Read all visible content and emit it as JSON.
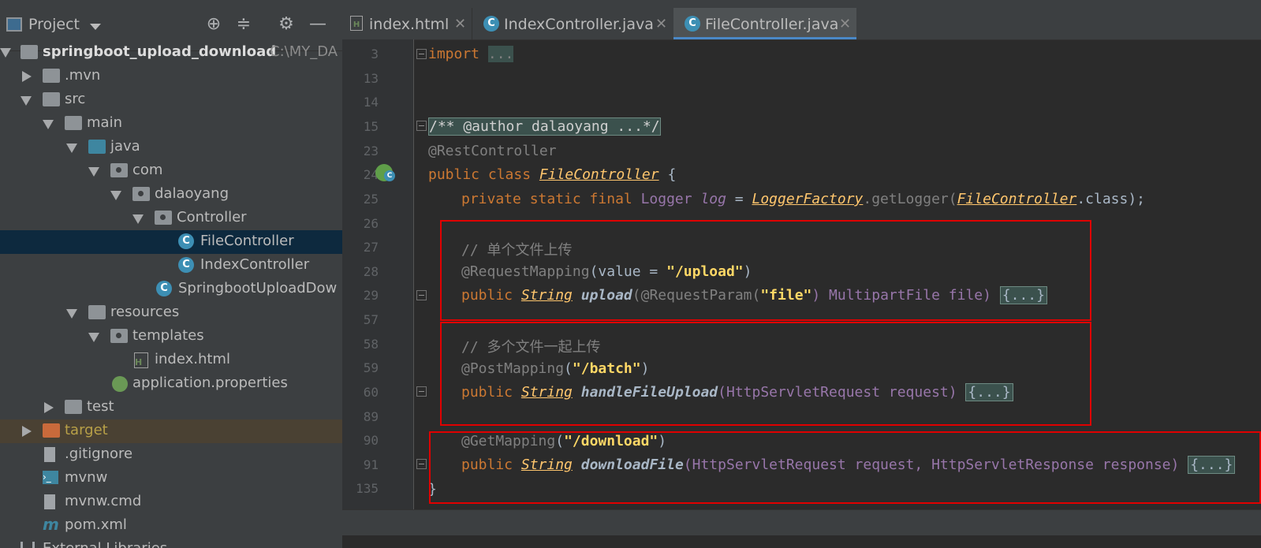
{
  "project_panel": {
    "title": "Project",
    "tree": [
      {
        "label": "springboot_upload_download",
        "path": "C:\\MY_DA"
      },
      {
        "label": ".mvn"
      },
      {
        "label": "src"
      },
      {
        "label": "main"
      },
      {
        "label": "java"
      },
      {
        "label": "com"
      },
      {
        "label": "dalaoyang"
      },
      {
        "label": "Controller"
      },
      {
        "label": "FileController"
      },
      {
        "label": "IndexController"
      },
      {
        "label": "SpringbootUploadDow"
      },
      {
        "label": "resources"
      },
      {
        "label": "templates"
      },
      {
        "label": "index.html"
      },
      {
        "label": "application.properties"
      },
      {
        "label": "test"
      },
      {
        "label": "target"
      },
      {
        "label": ".gitignore"
      },
      {
        "label": "mvnw"
      },
      {
        "label": "mvnw.cmd"
      },
      {
        "label": "pom.xml"
      }
    ],
    "partial_bottom": "External Libraries"
  },
  "tabs": [
    {
      "label": "index.html",
      "icon": "html-file-icon"
    },
    {
      "label": "IndexController.java",
      "icon": "class-icon"
    },
    {
      "label": "FileController.java",
      "icon": "class-icon",
      "active": true
    }
  ],
  "line_numbers": [
    "3",
    "13",
    "14",
    "15",
    "23",
    "24",
    "25",
    "26",
    "27",
    "28",
    "29",
    "57",
    "58",
    "59",
    "60",
    "89",
    "90",
    "91",
    "135"
  ],
  "code": {
    "l3_kw": "import",
    "l3_fold": "...",
    "l15": "/** @author dalaoyang ...*/",
    "l23": "@RestController",
    "l24_kw": "public class",
    "l24_name": "FileController",
    "l24_brace": " {",
    "l25_kw": "private static final",
    "l25_type": " Logger ",
    "l25_var": "log",
    "l25_eq": " = ",
    "l25_factory": "LoggerFactory",
    "l25_call": ".getLogger(",
    "l25_arg": "FileController",
    "l25_tail": ".class);",
    "l27": "// 单个文件上传",
    "l28_ann": "@RequestMapping",
    "l28_mid": "(value = ",
    "l28_str": "\"/upload\"",
    "l28_end": ")",
    "l29_kw": "public",
    "l29_type": "String",
    "l29_m": "upload",
    "l29_ann": "(@RequestParam(",
    "l29_str": "\"file\"",
    "l29_rest": ") MultipartFile file) ",
    "fold_body": "{...}",
    "l58": "// 多个文件一起上传",
    "l59_ann": "@PostMapping",
    "l59_str": "\"/batch\"",
    "l60_kw": "public",
    "l60_type": "String",
    "l60_m": "handleFileUpload",
    "l60_rest": "(HttpServletRequest request) ",
    "l90_ann": "@GetMapping",
    "l90_str": "\"/download\"",
    "l91_kw": "public",
    "l91_type": "String",
    "l91_m": "downloadFile",
    "l91_rest": "(HttpServletRequest request, HttpServletResponse response) ",
    "l135": "}"
  },
  "colors": {
    "keyword": "#cc7832",
    "string": "#6a8759",
    "annotation": "#bbb529",
    "comment": "#808080",
    "highlight_box": "#e00000"
  }
}
